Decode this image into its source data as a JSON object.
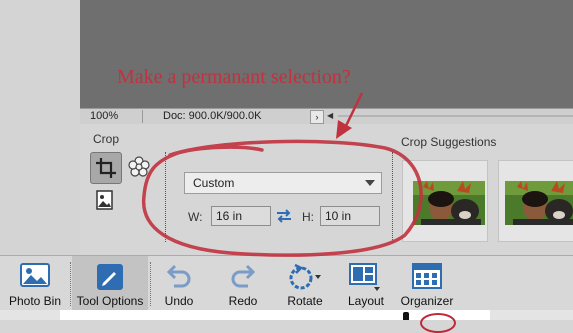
{
  "status_bar": {
    "zoom": "100%",
    "doc_info": "Doc: 900.0K/900.0K",
    "arrow": "›",
    "scroll_left": "◀"
  },
  "tool_options": {
    "title": "Crop",
    "preset": {
      "value": "Custom"
    },
    "width": {
      "label": "W:",
      "value": "16 in"
    },
    "height": {
      "label": "H:",
      "value": "10 in"
    },
    "suggestions_title": "Crop Suggestions"
  },
  "taskbar": {
    "items": [
      {
        "label": "Photo Bin",
        "icon": "photo-bin-icon"
      },
      {
        "label": "Tool Options",
        "icon": "tool-options-icon",
        "active": true
      },
      {
        "label": "Undo",
        "icon": "undo-icon"
      },
      {
        "label": "Redo",
        "icon": "redo-icon"
      },
      {
        "label": "Rotate",
        "icon": "rotate-icon"
      },
      {
        "label": "Layout",
        "icon": "layout-icon"
      },
      {
        "label": "Organizer",
        "icon": "organizer-icon"
      }
    ]
  },
  "annotation": {
    "text": "Make a permanant selection?",
    "color": "#c0323f"
  },
  "colors": {
    "canvas": "#6f6f6f",
    "panel": "#d6d6d6",
    "accent_blue": "#2f6db3"
  }
}
